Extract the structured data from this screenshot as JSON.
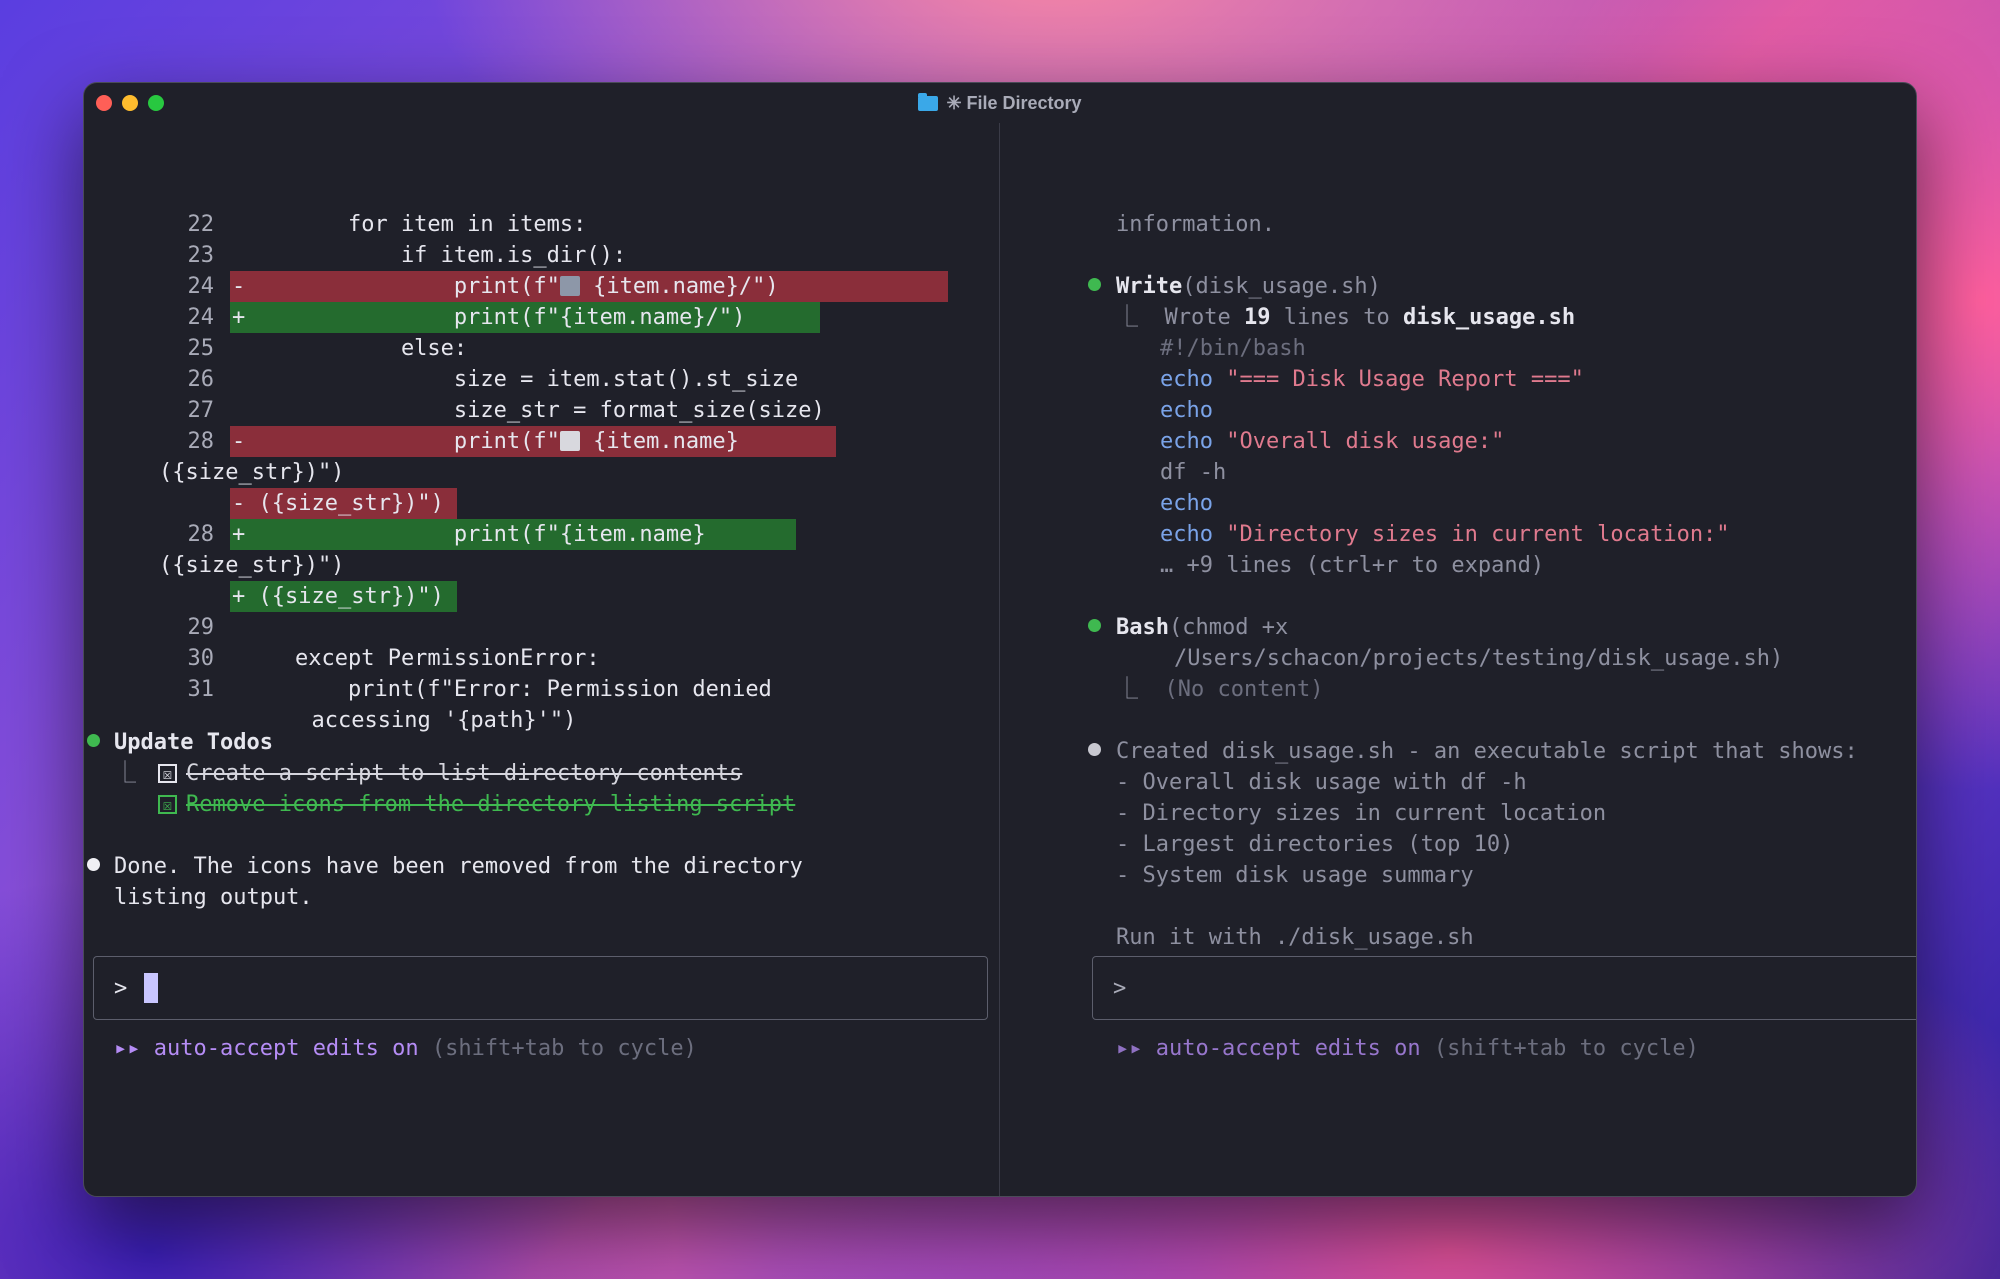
{
  "window": {
    "title": "✳ File Directory"
  },
  "left": {
    "code_lines": [
      {
        "num": "22",
        "text": "        for item in items:"
      },
      {
        "num": "23",
        "text": "            if item.is_dir():"
      },
      {
        "num": "24",
        "marker": "-",
        "text": "                print(f\"",
        "after": " {item.name}/\")"
      },
      {
        "num": "24",
        "marker": "+",
        "text": "                print(f\"{item.name}/\")"
      },
      {
        "num": "25",
        "text": "            else:"
      },
      {
        "num": "26",
        "text": "                size = item.stat().st_size"
      },
      {
        "num": "27",
        "text": "                size_str = format_size(size)"
      },
      {
        "num": "28",
        "marker": "-",
        "text": "                print(f\"",
        "after": " {item.name}"
      },
      {
        "wrap": "({size_str})\")"
      },
      {
        "marker_line": "- ({size_str})\")"
      },
      {
        "num": "28",
        "marker": "+",
        "text": "                print(f\"{item.name} "
      },
      {
        "wrap": "({size_str})\")"
      },
      {
        "marker_line": "+ ({size_str})\")"
      },
      {
        "num": "29",
        "text": ""
      },
      {
        "num": "30",
        "text": "    except PermissionError:"
      },
      {
        "num": "31",
        "text": "        print(f\"Error: Permission denied"
      },
      {
        "wrap": "  accessing '{path}'\")"
      }
    ],
    "todos_title": "Update Todos",
    "todo_branch": "⎿",
    "todos": [
      {
        "text": "Create a script to list directory contents",
        "check": "☒"
      },
      {
        "text": "Remove icons from the directory listing script",
        "check": "☒"
      }
    ],
    "done_line1": "Done. The icons have been removed from the directory",
    "done_line2": "listing output.",
    "prompt": ">",
    "status_arrows": "▸▸",
    "status_on": "auto-accept edits on",
    "status_hint": "(shift+tab to cycle)"
  },
  "right": {
    "top_text": "information.",
    "write_tool": "Write",
    "write_arg": "(disk_usage.sh)",
    "branch": "⎿",
    "wrote_pre": "Wrote ",
    "wrote_count": "19",
    "wrote_mid": " lines to ",
    "wrote_file": "disk_usage.sh",
    "shebang": "#!/bin/bash",
    "script_lines": [
      {
        "cmd": "echo",
        "str": "\"=== Disk Usage Report ===\""
      },
      {
        "cmd": "echo",
        "str": ""
      },
      {
        "cmd": "echo",
        "str": "\"Overall disk usage:\""
      },
      {
        "cmd": "df -h",
        "str": "",
        "plain": true
      },
      {
        "cmd": "echo",
        "str": ""
      },
      {
        "cmd": "echo",
        "str": "\"Directory sizes in current location:\""
      }
    ],
    "more_lines": "… +9 lines (ctrl+r to expand)",
    "bash_tool": "Bash",
    "bash_arg1": "(chmod +x",
    "bash_arg2": "/Users/schacon/projects/testing/disk_usage.sh)",
    "no_content": "(No content)",
    "created": "Created disk_usage.sh - an executable script that shows:",
    "features": [
      "- Overall disk usage with df -h",
      "- Directory sizes in current location",
      "- Largest directories (top 10)",
      "- System disk usage summary"
    ],
    "run_it": "Run it with ./disk_usage.sh",
    "prompt": ">",
    "status_arrows": "▸▸",
    "status_on": "auto-accept edits on",
    "status_hint": "(shift+tab to cycle)"
  }
}
